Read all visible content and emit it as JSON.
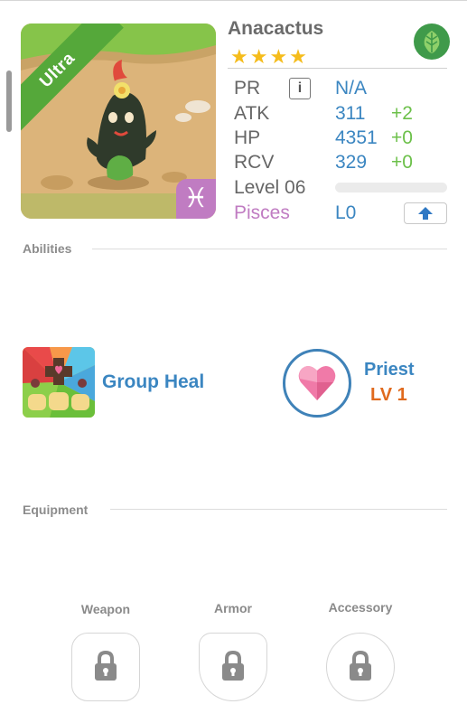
{
  "monster": {
    "name": "Anacactus",
    "rarity": "Ultra",
    "star_count": 4,
    "stars_display": "★★★★",
    "element_icon": "leaf-icon",
    "sign_symbol": "♓"
  },
  "stats": [
    {
      "label": "PR",
      "value": "N/A",
      "bonus": ""
    },
    {
      "label": "ATK",
      "value": "311",
      "bonus": "+2"
    },
    {
      "label": "HP",
      "value": "4351",
      "bonus": "+0"
    },
    {
      "label": "RCV",
      "value": "329",
      "bonus": "+0"
    }
  ],
  "level": {
    "label": "Level 06",
    "xp_fraction": 0.0
  },
  "zodiac": {
    "label": "Pisces",
    "value": "L0"
  },
  "abilities": {
    "title": "Abilities",
    "skill_name": "Group Heal",
    "class_name": "Priest",
    "class_level": "LV 1"
  },
  "equipment": {
    "title": "Equipment",
    "slots": [
      {
        "label": "Weapon",
        "icon": "lock-icon"
      },
      {
        "label": "Armor",
        "icon": "lock-icon"
      },
      {
        "label": "Accessory",
        "icon": "lock-icon"
      }
    ]
  },
  "colors": {
    "accent_blue": "#3b86c1",
    "bonus_green": "#6cc04a",
    "pisces_purple": "#c07cc2",
    "ribbon_green": "#55a83a",
    "star_gold": "#f5bc1c",
    "level_orange": "#e06a1e"
  }
}
